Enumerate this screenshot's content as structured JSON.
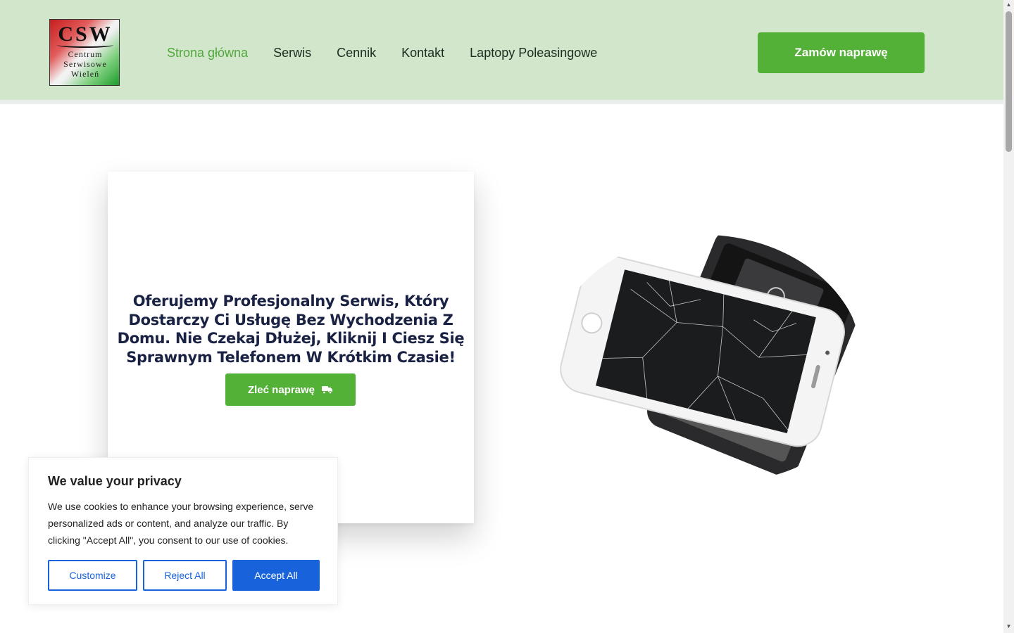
{
  "header": {
    "logo": {
      "main": "CSW",
      "sub_lines": [
        "Centrum",
        "Serwisowe",
        "Wieleń"
      ]
    },
    "nav": [
      {
        "label": "Strona główna",
        "active": true
      },
      {
        "label": "Serwis",
        "active": false
      },
      {
        "label": "Cennik",
        "active": false
      },
      {
        "label": "Kontakt",
        "active": false
      },
      {
        "label": "Laptopy Poleasingowe",
        "active": false
      }
    ],
    "cta_label": "Zamów naprawę"
  },
  "hero": {
    "title": "Oferujemy Profesjonalny Serwis, Który Dostarczy Ci Usługę Bez Wychodzenia Z Domu. Nie Czekaj Dłużej, Kliknij I Ciesz Się Sprawnym Telefonem W Krótkim Czasie!",
    "button_label": "Zleć naprawę",
    "button_icon": "truck-icon"
  },
  "cookie_banner": {
    "title": "We value your privacy",
    "text": "We use cookies to enhance your browsing experience, serve personalized ads or content, and analyze our traffic. By clicking \"Accept All\", you consent to our use of cookies.",
    "customize_label": "Customize",
    "reject_label": "Reject All",
    "accept_label": "Accept All"
  },
  "colors": {
    "header_bg": "#d1e6cb",
    "accent_green": "#54b138",
    "active_nav": "#52a83c",
    "title_navy": "#1a2244",
    "cookie_blue": "#1863dc"
  }
}
